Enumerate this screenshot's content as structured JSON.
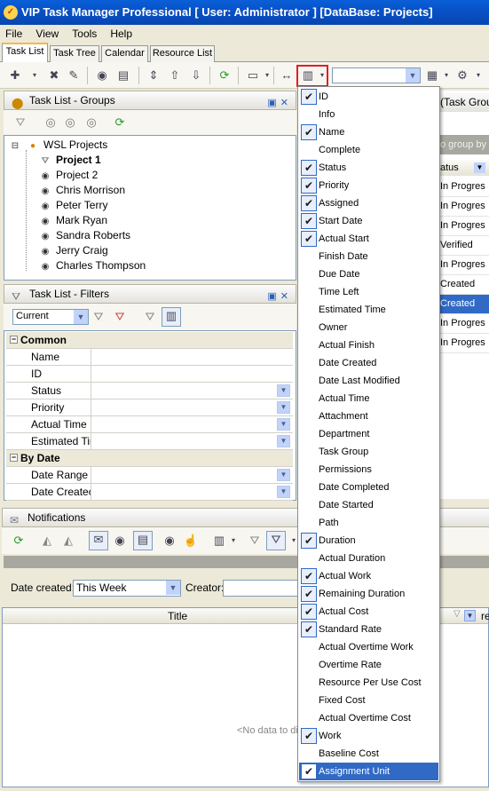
{
  "window": {
    "title": "VIP Task Manager Professional [ User: Administrator ] [DataBase: Projects]"
  },
  "menubar": [
    "File",
    "View",
    "Tools",
    "Help"
  ],
  "tabs": [
    "Task List",
    "Task Tree",
    "Calendar",
    "Resource List"
  ],
  "groups_panel": {
    "title": "Task List - Groups",
    "tree": [
      {
        "label": "WSL Projects",
        "bold": false,
        "level": 0
      },
      {
        "label": "Project 1",
        "bold": true,
        "level": 1
      },
      {
        "label": "Project 2",
        "bold": false,
        "level": 1
      },
      {
        "label": "Chris Morrison",
        "bold": false,
        "level": 1
      },
      {
        "label": "Peter Terry",
        "bold": false,
        "level": 1
      },
      {
        "label": "Mark Ryan",
        "bold": false,
        "level": 1
      },
      {
        "label": "Sandra Roberts",
        "bold": false,
        "level": 1
      },
      {
        "label": "Jerry Craig",
        "bold": false,
        "level": 1
      },
      {
        "label": "Charles Thompson",
        "bold": false,
        "level": 1
      }
    ]
  },
  "filters_panel": {
    "title": "Task List - Filters",
    "current_filter": "Current",
    "categories": [
      {
        "name": "Common",
        "fields": [
          {
            "label": "Name",
            "dropdown": false
          },
          {
            "label": "ID",
            "dropdown": false
          },
          {
            "label": "Status",
            "dropdown": true
          },
          {
            "label": "Priority",
            "dropdown": true
          },
          {
            "label": "Actual Time",
            "dropdown": true
          },
          {
            "label": "Estimated Tir",
            "dropdown": true
          }
        ]
      },
      {
        "name": "By Date",
        "fields": [
          {
            "label": "Date Range",
            "dropdown": true
          },
          {
            "label": "Date Createc",
            "dropdown": true
          }
        ]
      }
    ]
  },
  "notifications_panel": {
    "title": "Notifications",
    "date_created_label": "Date created:",
    "date_created_value": "This Week",
    "creator_label": "Creator:",
    "column_title": "Title",
    "column_partial": "re",
    "empty_text": "<No data to di"
  },
  "right_behind": {
    "header_fragment": "(Task Grou",
    "group_hint": "o group by t",
    "status_header": "atus",
    "status_rows": [
      "In Progres",
      "In Progres",
      "In Progres",
      "Verified",
      "In Progres",
      "Created",
      "Created",
      "In Progres",
      "In Progres"
    ]
  },
  "column_menu": {
    "items": [
      {
        "label": "ID",
        "checked": true
      },
      {
        "label": "Info",
        "checked": false
      },
      {
        "label": "Name",
        "checked": true
      },
      {
        "label": "Complete",
        "checked": false
      },
      {
        "label": "Status",
        "checked": true
      },
      {
        "label": "Priority",
        "checked": true
      },
      {
        "label": "Assigned",
        "checked": true
      },
      {
        "label": "Start Date",
        "checked": true
      },
      {
        "label": "Actual Start",
        "checked": true
      },
      {
        "label": "Finish Date",
        "checked": false
      },
      {
        "label": "Due Date",
        "checked": false
      },
      {
        "label": "Time Left",
        "checked": false
      },
      {
        "label": "Estimated Time",
        "checked": false
      },
      {
        "label": "Owner",
        "checked": false
      },
      {
        "label": "Actual Finish",
        "checked": false
      },
      {
        "label": "Date Created",
        "checked": false
      },
      {
        "label": "Date Last Modified",
        "checked": false
      },
      {
        "label": "Actual Time",
        "checked": false
      },
      {
        "label": "Attachment",
        "checked": false
      },
      {
        "label": "Department",
        "checked": false
      },
      {
        "label": "Task Group",
        "checked": false
      },
      {
        "label": "Permissions",
        "checked": false
      },
      {
        "label": "Date Completed",
        "checked": false
      },
      {
        "label": "Date Started",
        "checked": false
      },
      {
        "label": "Path",
        "checked": false
      },
      {
        "label": "Duration",
        "checked": true
      },
      {
        "label": "Actual Duration",
        "checked": false
      },
      {
        "label": "Actual Work",
        "checked": true
      },
      {
        "label": "Remaining Duration",
        "checked": true
      },
      {
        "label": "Actual Cost",
        "checked": true
      },
      {
        "label": "Standard Rate",
        "checked": true
      },
      {
        "label": "Actual Overtime Work",
        "checked": false
      },
      {
        "label": "Overtime Rate",
        "checked": false
      },
      {
        "label": "Resource Per Use Cost",
        "checked": false
      },
      {
        "label": "Fixed Cost",
        "checked": false
      },
      {
        "label": "Actual Overtime Cost",
        "checked": false
      },
      {
        "label": "Work",
        "checked": true
      },
      {
        "label": "Baseline Cost",
        "checked": false
      },
      {
        "label": "Assignment Unit",
        "checked": true
      }
    ],
    "selected_index": 38
  },
  "colors": {
    "title_bar": "#0852c8",
    "menu_selection": "#316ac5",
    "highlight_border": "#e02020"
  }
}
